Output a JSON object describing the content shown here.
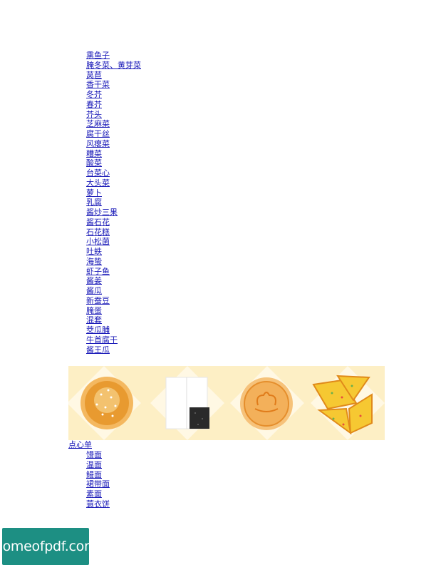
{
  "pickles_list": {
    "items": [
      "熏鱼子",
      "腌冬菜、黄芽菜",
      "莴苣",
      "香干菜",
      "冬芥",
      "春芥",
      "芥头",
      "芝麻菜",
      "腐干丝",
      "风瘪菜",
      "糟菜",
      "酸菜",
      "台菜心",
      "大头菜",
      "萝卜",
      "乳腐",
      "酱炒三果",
      "酱石花",
      "石花糕",
      "小松菌",
      "吐蛈",
      "海蛰",
      "虾子鱼",
      "酱姜",
      "酱瓜",
      "新蚕豆",
      "腌蛋",
      "混套",
      "茭瓜脯",
      "牛首腐干",
      "酱王瓜"
    ]
  },
  "banner": {
    "colors": {
      "background": "#fdefc5",
      "diamond": "#fff8e4",
      "pastry": "#f0a93a",
      "white_cake": "#ffffff",
      "seaweed": "#2a2a2a"
    }
  },
  "dim_sum": {
    "heading": "点心单",
    "items": [
      "馒面",
      "温面",
      "鳗面",
      "裙带面",
      "素面",
      "蓑衣饼"
    ]
  },
  "watermark": {
    "text": "homeofpdf.com",
    "color": "#1d8f83"
  }
}
